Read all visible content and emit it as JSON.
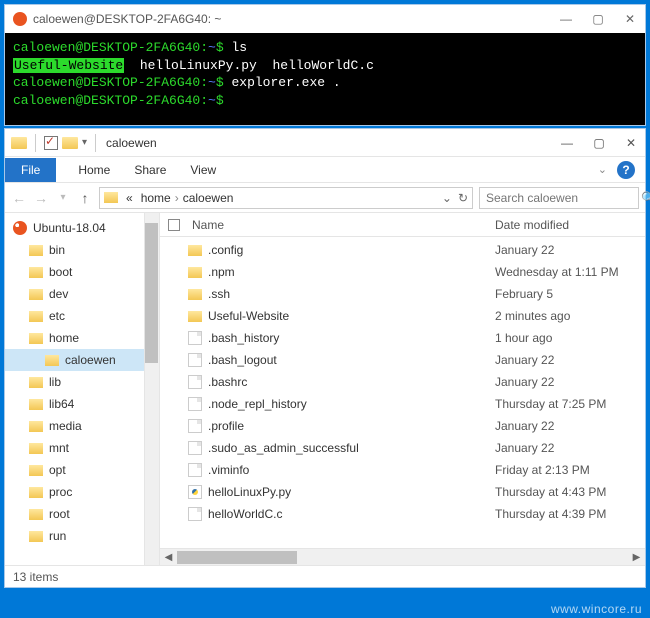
{
  "terminal": {
    "title": "caloewen@DESKTOP-2FA6G40: ~",
    "lines": [
      {
        "prompt": "caloewen@DESKTOP-2FA6G40",
        "path": "~",
        "cmd": "ls"
      },
      {
        "listing": {
          "dir": "Useful-Website",
          "f1": "helloLinuxPy.py",
          "f2": "helloWorldC.c"
        }
      },
      {
        "prompt": "caloewen@DESKTOP-2FA6G40",
        "path": "~",
        "cmd": "explorer.exe ."
      },
      {
        "prompt": "caloewen@DESKTOP-2FA6G40",
        "path": "~",
        "cmd": ""
      }
    ]
  },
  "explorer": {
    "title": "caloewen",
    "ribbon": {
      "file": "File",
      "home": "Home",
      "share": "Share",
      "view": "View"
    },
    "address": {
      "crumb0": "«",
      "crumb1": "home",
      "crumb2": "caloewen"
    },
    "search": {
      "placeholder": "Search caloewen"
    },
    "tree": {
      "root": "Ubuntu-18.04",
      "items": [
        "bin",
        "boot",
        "dev",
        "etc",
        "home",
        "caloewen",
        "lib",
        "lib64",
        "media",
        "mnt",
        "opt",
        "proc",
        "root",
        "run"
      ]
    },
    "headers": {
      "name": "Name",
      "date": "Date modified"
    },
    "files": [
      {
        "icon": "folder",
        "name": ".config",
        "date": "January 22"
      },
      {
        "icon": "folder",
        "name": ".npm",
        "date": "Wednesday at 1:11 PM"
      },
      {
        "icon": "folder",
        "name": ".ssh",
        "date": "February 5"
      },
      {
        "icon": "folder",
        "name": "Useful-Website",
        "date": "2 minutes ago"
      },
      {
        "icon": "file",
        "name": ".bash_history",
        "date": "1 hour ago"
      },
      {
        "icon": "file",
        "name": ".bash_logout",
        "date": "January 22"
      },
      {
        "icon": "file",
        "name": ".bashrc",
        "date": "January 22"
      },
      {
        "icon": "file",
        "name": ".node_repl_history",
        "date": "Thursday at 7:25 PM"
      },
      {
        "icon": "file",
        "name": ".profile",
        "date": "January 22"
      },
      {
        "icon": "file",
        "name": ".sudo_as_admin_successful",
        "date": "January 22"
      },
      {
        "icon": "file",
        "name": ".viminfo",
        "date": "Friday at 2:13 PM"
      },
      {
        "icon": "py",
        "name": "helloLinuxPy.py",
        "date": "Thursday at 4:43 PM"
      },
      {
        "icon": "file",
        "name": "helloWorldC.c",
        "date": "Thursday at 4:39 PM"
      }
    ],
    "status": "13 items"
  },
  "watermark": "www.wincore.ru"
}
